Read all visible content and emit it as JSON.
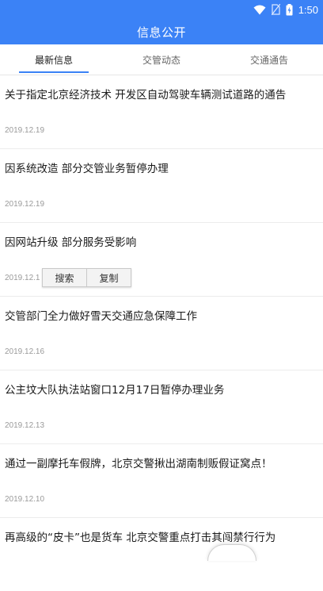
{
  "status_bar": {
    "time": "1:50",
    "icons": [
      "wifi-icon",
      "no-sim-icon",
      "battery-icon"
    ]
  },
  "app_bar": {
    "title": "信息公开"
  },
  "tabs": [
    {
      "label": "最新信息",
      "active": true
    },
    {
      "label": "交管动态",
      "active": false
    },
    {
      "label": "交通通告",
      "active": false
    }
  ],
  "articles": [
    {
      "title": " 关于指定北京经济技术 开发区自动驾驶车辆测试道路的通告",
      "date": "2019.12.19"
    },
    {
      "title": "因系统改造 部分交管业务暂停办理",
      "date": "2019.12.19"
    },
    {
      "title": "因网站升级 部分服务受影响",
      "date": "2019.12.1"
    },
    {
      "title": "交管部门全力做好雪天交通应急保障工作",
      "date": "2019.12.16"
    },
    {
      "title": "公主坟大队执法站窗口12月17日暂停办理业务",
      "date": "2019.12.13"
    },
    {
      "title": "通过一副摩托车假牌，北京交警揪出湖南制贩假证窝点！",
      "date": "2019.12.10"
    },
    {
      "title": "再高级的“皮卡”也是货车 北京交警重点打击其闯禁行行为",
      "date": ""
    }
  ],
  "context_menu": {
    "search_label": "搜索",
    "copy_label": "复制"
  },
  "colors": {
    "primary": "#3b82f6",
    "text": "#1a1a1a",
    "date": "#9a9a9a"
  }
}
